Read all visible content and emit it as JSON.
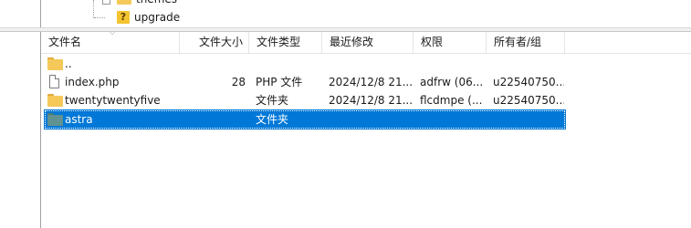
{
  "tree": {
    "nodes": [
      {
        "label": "themes",
        "icon": "folder-icon"
      },
      {
        "label": "upgrade",
        "icon": "question-icon"
      }
    ]
  },
  "file_list": {
    "columns": [
      "文件名",
      "文件大小",
      "文件类型",
      "最近修改",
      "权限",
      "所有者/组"
    ],
    "rows": [
      {
        "name": "..",
        "size": "",
        "type": "",
        "modified": "",
        "permissions": "",
        "owner": "",
        "icon": "folder-icon",
        "selected": false
      },
      {
        "name": "index.php",
        "size": "28",
        "type": "PHP 文件",
        "modified": "2024/12/8 21...",
        "permissions": "adfrw (06...",
        "owner": "u22540750...",
        "icon": "file-icon",
        "selected": false
      },
      {
        "name": "twentytwentyfive",
        "size": "",
        "type": "文件夹",
        "modified": "2024/12/8 21...",
        "permissions": "flcdmpe (...",
        "owner": "u22540750...",
        "icon": "folder-icon",
        "selected": false
      },
      {
        "name": "astra",
        "size": "",
        "type": "文件夹",
        "modified": "",
        "permissions": "",
        "owner": "",
        "icon": "folder-icon",
        "selected": true
      }
    ]
  },
  "colors": {
    "selection": "#0078d7",
    "folder": "#f4c95a",
    "selected_folder": "#5f9290"
  }
}
